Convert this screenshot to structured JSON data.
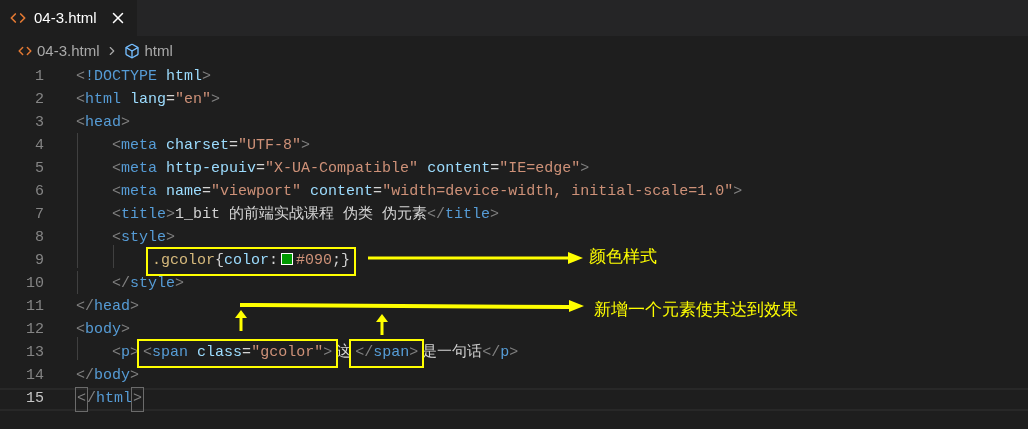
{
  "tab": {
    "title": "04-3.html",
    "selected": true
  },
  "breadcrumb": [
    {
      "kind": "file",
      "label": "04-3.html"
    },
    {
      "kind": "element",
      "label": "html"
    }
  ],
  "lines": [
    {
      "number": "1",
      "current": false,
      "segments": [
        {
          "kind": "plain",
          "tokens": [
            {
              "kind": "punct",
              "text": "<"
            },
            {
              "kind": "tag",
              "text": "!DOCTYPE"
            },
            {
              "kind": "attr",
              "text": " html"
            },
            {
              "kind": "punct",
              "text": ">"
            }
          ]
        }
      ]
    },
    {
      "number": "2",
      "current": false,
      "segments": [
        {
          "kind": "plain",
          "tokens": [
            {
              "kind": "punct",
              "text": "<"
            },
            {
              "kind": "tag",
              "text": "html"
            },
            {
              "kind": "attr",
              "text": " lang"
            },
            {
              "kind": "text",
              "text": "="
            },
            {
              "kind": "str",
              "text": "\"en\""
            },
            {
              "kind": "punct",
              "text": ">"
            }
          ]
        }
      ]
    },
    {
      "number": "3",
      "current": false,
      "segments": [
        {
          "kind": "plain",
          "tokens": [
            {
              "kind": "punct",
              "text": "<"
            },
            {
              "kind": "tag",
              "text": "head"
            },
            {
              "kind": "punct",
              "text": ">"
            }
          ]
        }
      ]
    },
    {
      "number": "4",
      "current": false,
      "segments": [
        {
          "kind": "plain",
          "tokens": [
            {
              "kind": "punct",
              "text": "    <"
            },
            {
              "kind": "tag",
              "text": "meta"
            },
            {
              "kind": "attr",
              "text": " charset"
            },
            {
              "kind": "text",
              "text": "="
            },
            {
              "kind": "str",
              "text": "\"UTF-8\""
            },
            {
              "kind": "punct",
              "text": ">"
            }
          ]
        }
      ]
    },
    {
      "number": "5",
      "current": false,
      "segments": [
        {
          "kind": "plain",
          "tokens": [
            {
              "kind": "punct",
              "text": "    <"
            },
            {
              "kind": "tag",
              "text": "meta"
            },
            {
              "kind": "attr",
              "text": " http-epuiv"
            },
            {
              "kind": "text",
              "text": "="
            },
            {
              "kind": "str",
              "text": "\"X-UA-Compatible\""
            },
            {
              "kind": "attr",
              "text": " content"
            },
            {
              "kind": "text",
              "text": "="
            },
            {
              "kind": "str",
              "text": "\"IE=edge\""
            },
            {
              "kind": "punct",
              "text": ">"
            }
          ]
        }
      ]
    },
    {
      "number": "6",
      "current": false,
      "segments": [
        {
          "kind": "plain",
          "tokens": [
            {
              "kind": "punct",
              "text": "    <"
            },
            {
              "kind": "tag",
              "text": "meta"
            },
            {
              "kind": "attr",
              "text": " name"
            },
            {
              "kind": "text",
              "text": "="
            },
            {
              "kind": "str",
              "text": "\"viewport\""
            },
            {
              "kind": "attr",
              "text": " content"
            },
            {
              "kind": "text",
              "text": "="
            },
            {
              "kind": "str",
              "text": "\"width=device-width, initial-scale=1.0\""
            },
            {
              "kind": "punct",
              "text": ">"
            }
          ]
        }
      ]
    },
    {
      "number": "7",
      "current": false,
      "segments": [
        {
          "kind": "plain",
          "tokens": [
            {
              "kind": "punct",
              "text": "    <"
            },
            {
              "kind": "tag",
              "text": "title"
            },
            {
              "kind": "punct",
              "text": ">"
            },
            {
              "kind": "text",
              "text": "1_bit 的前端实战课程 伪类 伪元素"
            },
            {
              "kind": "punct",
              "text": "</"
            },
            {
              "kind": "tag",
              "text": "title"
            },
            {
              "kind": "punct",
              "text": ">"
            }
          ]
        }
      ]
    },
    {
      "number": "8",
      "current": false,
      "segments": [
        {
          "kind": "plain",
          "tokens": [
            {
              "kind": "punct",
              "text": "    <"
            },
            {
              "kind": "tag",
              "text": "style"
            },
            {
              "kind": "punct",
              "text": ">"
            }
          ]
        }
      ]
    },
    {
      "number": "9",
      "current": false,
      "segments": [
        {
          "kind": "boxed",
          "tokens": [
            {
              "kind": "selector",
              "text": "        .gcolor"
            },
            {
              "kind": "text",
              "text": "{"
            },
            {
              "kind": "attr",
              "text": "color"
            },
            {
              "kind": "text",
              "text": ":"
            },
            {
              "kind": "swatch",
              "color": "#009900"
            },
            {
              "kind": "str",
              "text": "#090"
            },
            {
              "kind": "text",
              "text": ";}"
            }
          ]
        }
      ]
    },
    {
      "number": "10",
      "current": false,
      "segments": [
        {
          "kind": "plain",
          "tokens": [
            {
              "kind": "punct",
              "text": "    </"
            },
            {
              "kind": "tag",
              "text": "style"
            },
            {
              "kind": "punct",
              "text": ">"
            }
          ]
        }
      ]
    },
    {
      "number": "11",
      "current": false,
      "segments": [
        {
          "kind": "plain",
          "tokens": [
            {
              "kind": "punct",
              "text": "</"
            },
            {
              "kind": "tag",
              "text": "head"
            },
            {
              "kind": "punct",
              "text": ">"
            }
          ]
        }
      ]
    },
    {
      "number": "12",
      "current": false,
      "segments": [
        {
          "kind": "plain",
          "tokens": [
            {
              "kind": "punct",
              "text": "<"
            },
            {
              "kind": "tag",
              "text": "body"
            },
            {
              "kind": "punct",
              "text": ">"
            }
          ]
        }
      ]
    },
    {
      "number": "13",
      "current": false,
      "segments": [
        {
          "kind": "plain",
          "tokens": [
            {
              "kind": "punct",
              "text": "    <"
            },
            {
              "kind": "tag",
              "text": "p"
            },
            {
              "kind": "punct",
              "text": ">"
            }
          ]
        },
        {
          "kind": "boxed",
          "tokens": [
            {
              "kind": "punct",
              "text": "<"
            },
            {
              "kind": "tag",
              "text": "span"
            },
            {
              "kind": "attr",
              "text": " class"
            },
            {
              "kind": "text",
              "text": "="
            },
            {
              "kind": "str",
              "text": "\"gcolor\""
            },
            {
              "kind": "punct",
              "text": ">"
            }
          ]
        },
        {
          "kind": "plain",
          "tokens": [
            {
              "kind": "text",
              "text": "这"
            }
          ]
        },
        {
          "kind": "boxed",
          "tokens": [
            {
              "kind": "punct",
              "text": "</"
            },
            {
              "kind": "tag",
              "text": "span"
            },
            {
              "kind": "punct",
              "text": ">"
            }
          ]
        },
        {
          "kind": "plain",
          "tokens": [
            {
              "kind": "text",
              "text": "是一句话"
            },
            {
              "kind": "punct",
              "text": "</"
            },
            {
              "kind": "tag",
              "text": "p"
            },
            {
              "kind": "punct",
              "text": ">"
            }
          ]
        }
      ]
    },
    {
      "number": "14",
      "current": false,
      "segments": [
        {
          "kind": "plain",
          "tokens": [
            {
              "kind": "punct",
              "text": "</"
            },
            {
              "kind": "tag",
              "text": "body"
            },
            {
              "kind": "punct",
              "text": ">"
            }
          ]
        }
      ]
    },
    {
      "number": "15",
      "current": true,
      "segments": [
        {
          "kind": "matched",
          "tokens": [
            {
              "kind": "punct",
              "text": "<"
            }
          ]
        },
        {
          "kind": "plain",
          "tokens": [
            {
              "kind": "punct",
              "text": "/"
            },
            {
              "kind": "tag",
              "text": "html"
            }
          ]
        },
        {
          "kind": "matched",
          "tokens": [
            {
              "kind": "punct",
              "text": ">"
            }
          ]
        }
      ]
    }
  ],
  "annotations": [
    {
      "text": "颜色样式"
    },
    {
      "text": "新增一个元素使其达到效果"
    }
  ]
}
